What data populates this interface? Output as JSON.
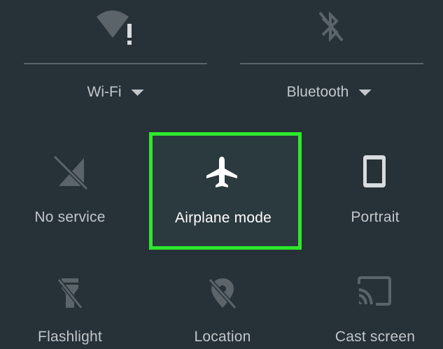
{
  "quick_settings": {
    "wifi": {
      "label": "Wi-Fi",
      "icon": "wifi-alert-icon"
    },
    "bluetooth": {
      "label": "Bluetooth",
      "icon": "bluetooth-off-icon"
    },
    "tiles": [
      {
        "label": "No service",
        "icon": "signal-off-icon"
      },
      {
        "label": "Airplane mode",
        "icon": "airplane-icon"
      },
      {
        "label": "Portrait",
        "icon": "phone-portrait-icon"
      },
      {
        "label": "Flashlight",
        "icon": "flashlight-off-icon"
      },
      {
        "label": "Location",
        "icon": "location-off-icon"
      },
      {
        "label": "Cast screen",
        "icon": "cast-icon"
      }
    ]
  },
  "colors": {
    "background": "#263238",
    "highlight": "#2ee82c",
    "icon_dim": "#5b6468",
    "text": "#c2c7ca"
  }
}
